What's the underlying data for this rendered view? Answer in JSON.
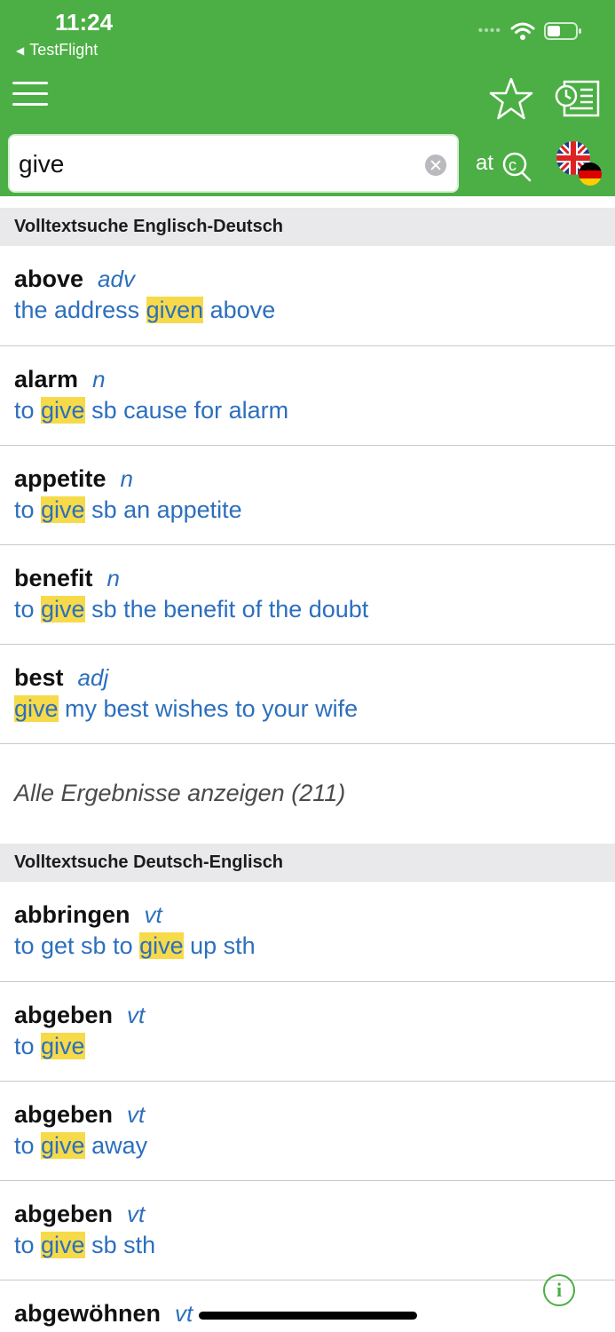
{
  "status_bar": {
    "time": "11:24",
    "back_app": "TestFlight",
    "icons": [
      "signal-dots-icon",
      "wifi-icon",
      "battery-icon"
    ]
  },
  "toolbar": {
    "icons": [
      "hamburger-menu-icon",
      "star-icon",
      "history-list-icon",
      "spell-check-icon",
      "uk-german-flag-icon"
    ]
  },
  "search": {
    "value": "give",
    "placeholder": ""
  },
  "sections": [
    {
      "title": "Volltextsuche Englisch-Deutsch",
      "items": [
        {
          "word": "above",
          "pos": "adv",
          "before": "the address ",
          "match": "given",
          "after": " above"
        },
        {
          "word": "alarm",
          "pos": "n",
          "before": "to ",
          "match": "give",
          "after": " sb cause for alarm"
        },
        {
          "word": "appetite",
          "pos": "n",
          "before": "to ",
          "match": "give",
          "after": " sb an appetite"
        },
        {
          "word": "benefit",
          "pos": "n",
          "before": "to ",
          "match": "give",
          "after": " sb the benefit of the doubt"
        },
        {
          "word": "best",
          "pos": "adj",
          "before": "",
          "match": "give",
          "after": " my best wishes to your wife"
        }
      ],
      "show_all": "Alle Ergebnisse anzeigen (211)"
    },
    {
      "title": "Volltextsuche Deutsch-Englisch",
      "items": [
        {
          "word": "abbringen",
          "pos": "vt",
          "before": "to get sb to ",
          "match": "give",
          "after": " up sth"
        },
        {
          "word": "abgeben",
          "pos": "vt",
          "before": "to ",
          "match": "give",
          "after": ""
        },
        {
          "word": "abgeben",
          "pos": "vt",
          "before": "to ",
          "match": "give",
          "after": " away"
        },
        {
          "word": "abgeben",
          "pos": "vt",
          "before": "to ",
          "match": "give",
          "after": " sb sth"
        },
        {
          "word": "abgewöhnen",
          "pos": "vt",
          "before": "",
          "match": "",
          "after": ""
        }
      ]
    }
  ],
  "colors": {
    "brand_green": "#4caf45",
    "link_blue": "#2c6fbd",
    "highlight_yellow": "#f6da4a"
  }
}
